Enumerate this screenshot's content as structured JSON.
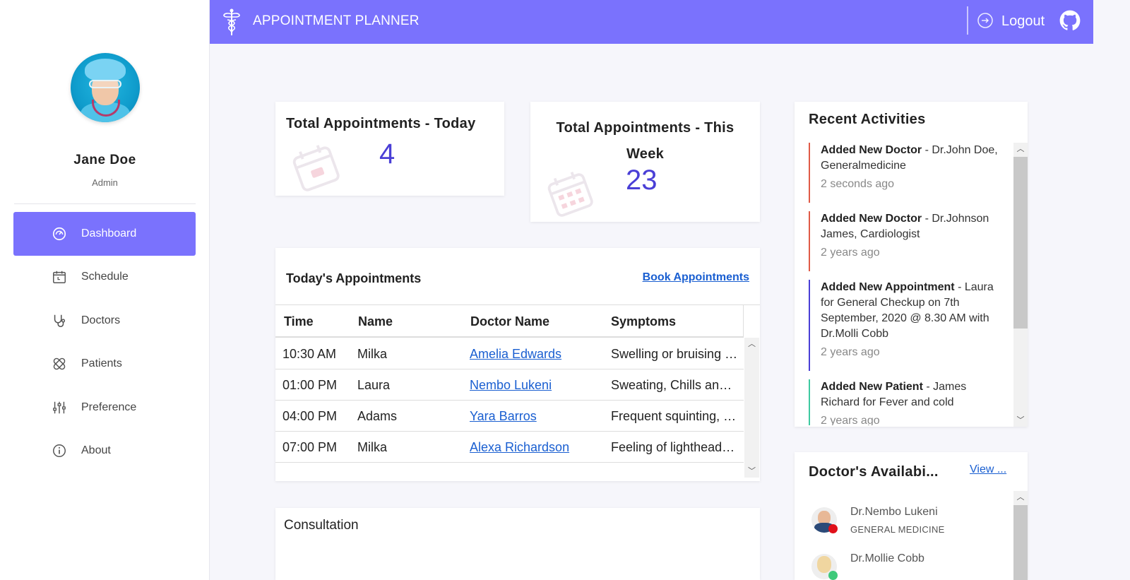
{
  "app": {
    "title": "APPOINTMENT PLANNER"
  },
  "header": {
    "logout_label": "Logout"
  },
  "user": {
    "name": "Jane Doe",
    "role": "Admin"
  },
  "sidebar": {
    "items": [
      {
        "label": "Dashboard",
        "icon": "dashboard-icon",
        "active": true
      },
      {
        "label": "Schedule",
        "icon": "calendar-icon"
      },
      {
        "label": "Doctors",
        "icon": "stethoscope-icon"
      },
      {
        "label": "Patients",
        "icon": "bandage-icon"
      },
      {
        "label": "Preference",
        "icon": "sliders-icon"
      },
      {
        "label": "About",
        "icon": "info-icon"
      }
    ]
  },
  "stats": {
    "today": {
      "title": "Total Appointments - Today",
      "value": "4"
    },
    "week": {
      "title": "Total Appointments - This Week",
      "value": "23"
    }
  },
  "appointments": {
    "title": "Today's Appointments",
    "book_label": "Book Appointments",
    "columns": [
      "Time",
      "Name",
      "Doctor Name",
      "Symptoms"
    ],
    "rows": [
      {
        "time": "10:30 AM",
        "name": "Milka",
        "doctor": "Amelia Edwards",
        "symptoms": "Swelling or bruising over a bone"
      },
      {
        "time": "01:00 PM",
        "name": "Laura",
        "doctor": "Nembo Lukeni",
        "symptoms": "Sweating, Chills and Shivering"
      },
      {
        "time": "04:00 PM",
        "name": "Adams",
        "doctor": "Yara Barros",
        "symptoms": "Frequent squinting, Eye strain"
      },
      {
        "time": "07:00 PM",
        "name": "Milka",
        "doctor": "Alexa Richardson",
        "symptoms": "Feeling of lightheadedness"
      }
    ]
  },
  "recent_activities": {
    "title": "Recent Activities",
    "items": [
      {
        "action": "Added New Doctor",
        "detail": " - Dr.John Doe, Generalmedicine",
        "time": "2 seconds ago",
        "color": "#e05a47"
      },
      {
        "action": "Added New Doctor",
        "detail": " - Dr.Johnson James, Cardiologist",
        "time": "2 years ago",
        "color": "#e05a47"
      },
      {
        "action": "Added New Appointment",
        "detail": " - Laura for General Checkup on 7th September, 2020 @ 8.30 AM with Dr.Molli Cobb",
        "time": "2 years ago",
        "color": "#4a3fd6"
      },
      {
        "action": "Added New Patient",
        "detail": " - James Richard for Fever and cold",
        "time": "2 years ago",
        "color": "#3ec9a0"
      }
    ]
  },
  "availability": {
    "title": "Doctor's Availabi...",
    "view_label": "View ...",
    "doctors": [
      {
        "name": "Dr.Nembo Lukeni",
        "specialty": "GENERAL MEDICINE",
        "status_color": "#e0101a"
      },
      {
        "name": "Dr.Mollie Cobb",
        "specialty": "",
        "status_color": "#3ec97a"
      }
    ]
  },
  "consultation": {
    "title": "Consultation"
  },
  "colors": {
    "accent": "#7a72fd",
    "stat_value": "#4a3fd6",
    "link": "#1a5fd1"
  }
}
